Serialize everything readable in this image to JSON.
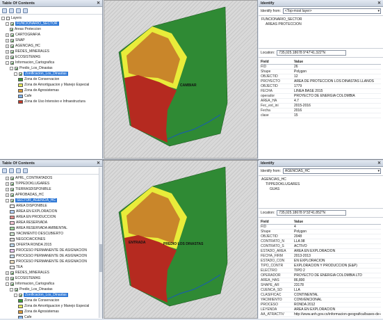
{
  "top": {
    "toc": {
      "title": "Table Of Contents",
      "rows": [
        {
          "indent": 0,
          "exp": "-",
          "cb": false,
          "label": "Layers",
          "sel": false
        },
        {
          "indent": 1,
          "exp": "-",
          "cb": true,
          "label": "FUNCIONARIO_SECTOR",
          "sel": true
        },
        {
          "indent": 2,
          "exp": "",
          "cb": true,
          "label": "Areas Proteccion",
          "sel": false
        },
        {
          "indent": 1,
          "exp": "+",
          "cb": true,
          "label": "CARTOGRAFIA",
          "sel": false
        },
        {
          "indent": 1,
          "exp": "+",
          "cb": true,
          "label": "SNAP",
          "sel": false
        },
        {
          "indent": 1,
          "exp": "+",
          "cb": true,
          "label": "AGENCIAS_HC",
          "sel": false
        },
        {
          "indent": 1,
          "exp": "+",
          "cb": true,
          "label": "REDES_MINERALES",
          "sel": false
        },
        {
          "indent": 1,
          "exp": "+",
          "cb": true,
          "label": "ECOSISTEMAS",
          "sel": false
        },
        {
          "indent": 1,
          "exp": "-",
          "cb": true,
          "label": "Informacion_Cartografica",
          "sel": false
        },
        {
          "indent": 2,
          "exp": "-",
          "cb": true,
          "label": "Predio_Los_Dinastas",
          "sel": false
        },
        {
          "indent": 3,
          "exp": "-",
          "cb": true,
          "label": "Zonificacion_Los_Dinastas",
          "sel": true
        },
        {
          "indent": 4,
          "exp": "",
          "sw": "#3a9a3a",
          "label": "Zona de Conservacion",
          "sel": false
        },
        {
          "indent": 4,
          "exp": "",
          "sw": "#e8e85a",
          "label": "Zona de Amortiguacion y Manejo Especial",
          "sel": false
        },
        {
          "indent": 4,
          "exp": "",
          "sw": "#d99a3a",
          "label": "Zona de Agrosistemas",
          "sel": false
        },
        {
          "indent": 4,
          "exp": "",
          "sw": "#7fb0e8",
          "label": "Cafe",
          "sel": false
        },
        {
          "indent": 4,
          "exp": "",
          "sw": "#c23a2a",
          "label": "Zona de Uso Intensivo e Infraestructura",
          "sel": false
        }
      ]
    },
    "map": {
      "label": "CAMBIAR"
    },
    "identify": {
      "title": "Identify",
      "from_label": "Identify from:",
      "from_value": "<Top-most layer>",
      "tree": [
        "FUNCIONARIO_SECTOR",
        "AREAS PROTECCION"
      ],
      "loc_label": "Location:",
      "loc_value": "735,025.18678  9°47'41.322\"N",
      "head_k": "Field",
      "head_v": "Value",
      "attrs": [
        [
          "FID",
          "26"
        ],
        [
          "Shape",
          "Polygon"
        ],
        [
          "OBJECTID",
          "12"
        ],
        [
          "PROYECTO",
          "AREA DE PROTECCION LOS DINASTAS LLANOS"
        ],
        [
          "OBJECTID",
          "1779"
        ],
        [
          "FECHA",
          "LINEA BASE 2015"
        ],
        [
          "operador",
          "PROYECTO DE ENERGIA COLOMBIA"
        ],
        [
          "AREA_HA",
          "4.7"
        ],
        [
          "Fec_ext_ini",
          "2015-2016"
        ],
        [
          "Fecha",
          "2016"
        ],
        [
          "clase",
          "15"
        ]
      ]
    }
  },
  "bot": {
    "toc": {
      "title": "Table Of Contents",
      "rows": [
        {
          "indent": 1,
          "exp": "+",
          "cb": true,
          "label": "APRL_CONTRATADOS",
          "sel": false
        },
        {
          "indent": 1,
          "exp": "+",
          "cb": true,
          "label": "TIPPEDOKLUGARES",
          "sel": false
        },
        {
          "indent": 1,
          "exp": "+",
          "cb": true,
          "label": "TIERRASDISPONIBLE",
          "sel": false
        },
        {
          "indent": 1,
          "exp": "+",
          "cb": true,
          "label": "APROBADAS_HC",
          "sel": false
        },
        {
          "indent": 1,
          "exp": "-",
          "cb": true,
          "label": "SECTOR_AGENCIA_HC",
          "sel": true
        },
        {
          "indent": 2,
          "exp": "",
          "sw": "#f2f2f2",
          "label": "AREA DISPONIBLE",
          "sel": false
        },
        {
          "indent": 2,
          "exp": "",
          "sw": "#b8d4ff",
          "label": "AREA EN EXPLORACION",
          "sel": false
        },
        {
          "indent": 2,
          "exp": "",
          "sw": "#e08a8a",
          "label": "AREA EN PRODUCCION",
          "sel": false
        },
        {
          "indent": 2,
          "exp": "",
          "sw": "#f5c6d6",
          "label": "AREA RESERVADA",
          "sel": false
        },
        {
          "indent": 2,
          "exp": "",
          "sw": "#9fd49f",
          "label": "AREA RESERVADA AMBIENTAL",
          "sel": false
        },
        {
          "indent": 2,
          "exp": "",
          "sw": "#cfe6cf",
          "label": "YACIMIENTO DESCUBIERTO",
          "sel": false
        },
        {
          "indent": 2,
          "exp": "",
          "sw": "#d9d9d9",
          "label": "NEGOCIACIONES",
          "sel": false
        },
        {
          "indent": 2,
          "exp": "",
          "sw": "#bcd7ec",
          "label": "OFERTA RONDA 2015",
          "sel": false
        },
        {
          "indent": 2,
          "exp": "",
          "sw": "#e8c8f0",
          "label": "PROCESO PERMANENTE DE ASIGNACION",
          "sel": false
        },
        {
          "indent": 2,
          "exp": "",
          "sw": "#cce0f5",
          "label": "PROCESO PERMANENTE DE ASIGNACION",
          "sel": false
        },
        {
          "indent": 2,
          "exp": "",
          "sw": "#f0e0c0",
          "label": "PROCESO PERMANENTE DE ASIGNACION",
          "sel": false
        },
        {
          "indent": 2,
          "exp": "",
          "sw": "#ffffff",
          "label": "TEA",
          "sel": false
        },
        {
          "indent": 1,
          "exp": "+",
          "cb": true,
          "label": "REDES_MINERALES",
          "sel": false
        },
        {
          "indent": 1,
          "exp": "+",
          "cb": true,
          "label": "ECOSISTEMAS",
          "sel": false
        },
        {
          "indent": 1,
          "exp": "-",
          "cb": true,
          "label": "Informacion_Cartografica",
          "sel": false
        },
        {
          "indent": 2,
          "exp": "-",
          "cb": true,
          "label": "Predio_Los_Dinastas",
          "sel": false
        },
        {
          "indent": 3,
          "exp": "-",
          "cb": true,
          "label": "Zonificacion_Los_Dinastas",
          "sel": true
        },
        {
          "indent": 4,
          "exp": "",
          "sw": "#3a9a3a",
          "label": "Zona de Conservacion",
          "sel": false
        },
        {
          "indent": 4,
          "exp": "",
          "sw": "#e8e85a",
          "label": "Zona de Amortiguacion y Manejo Especial",
          "sel": false
        },
        {
          "indent": 4,
          "exp": "",
          "sw": "#d99a3a",
          "label": "Zona de Agrosistemas",
          "sel": false
        },
        {
          "indent": 4,
          "exp": "",
          "sw": "#7fb0e8",
          "label": "Cafe",
          "sel": false
        },
        {
          "indent": 4,
          "exp": "",
          "sw": "#c23a2a",
          "label": "Zona de Uso Intensivo e Infraestructura",
          "sel": false
        }
      ]
    },
    "map": {
      "label_a": "ENTRADA",
      "label_b": "PREDIO LOS DINASTAS"
    },
    "identify": {
      "title": "Identify",
      "from_label": "Identify from:",
      "from_value": "AGENCIAS_HC",
      "tree": [
        "AGENCIAS_HC",
        "TIPPEDOKLUGARES",
        "GUAS"
      ],
      "loc_label": "Location:",
      "loc_value": "735,025.18678  9°32'41.852\"N",
      "head_k": "Field",
      "head_v": "Value",
      "attrs": [
        [
          "FID",
          "4"
        ],
        [
          "Shape",
          "Polygon"
        ],
        [
          "OBJECTID",
          "2048"
        ],
        [
          "CONTRATO_N",
          "LLA 98"
        ],
        [
          "CONTRATO_S",
          "ACTIVO"
        ],
        [
          "ESTADO_AREA",
          "AREA EN EXPLORACION"
        ],
        [
          "FECHA_FIRM",
          "2013-2013"
        ],
        [
          "ESTADO_CON",
          "EN EXPLORACION"
        ],
        [
          "TIPO_CONTR",
          "EXPLORACION Y PRODUCCION (E&P)"
        ],
        [
          "ELECTRO",
          "TIPO 2"
        ],
        [
          "OPERADOR",
          "PROYECTO DE ENERGIA COLOMBIA LTD"
        ],
        [
          "AREA_HAS",
          "86,800"
        ],
        [
          "SHAPE_AR",
          "23178"
        ],
        [
          "CUENCA_SD",
          "LLA"
        ],
        [
          "CLASIFICAC",
          "CONTINENTAL"
        ],
        [
          "YACIMIENTO",
          "CONVENCIONAL"
        ],
        [
          "PROCESO",
          "RONDA 2012"
        ],
        [
          "LEYENDA",
          "AREA EN EXPLORACION"
        ],
        [
          "AA_ATRACTIV",
          "http://www.anh.gov.co/informacion-geografica/bases-de-datos"
        ]
      ]
    }
  },
  "colors": {
    "green": "#2f8a34",
    "yellow": "#e9ec3a",
    "orange": "#c9862a",
    "red": "#b52a20",
    "river": "#1a5fa8",
    "selection": "#3079d6"
  }
}
